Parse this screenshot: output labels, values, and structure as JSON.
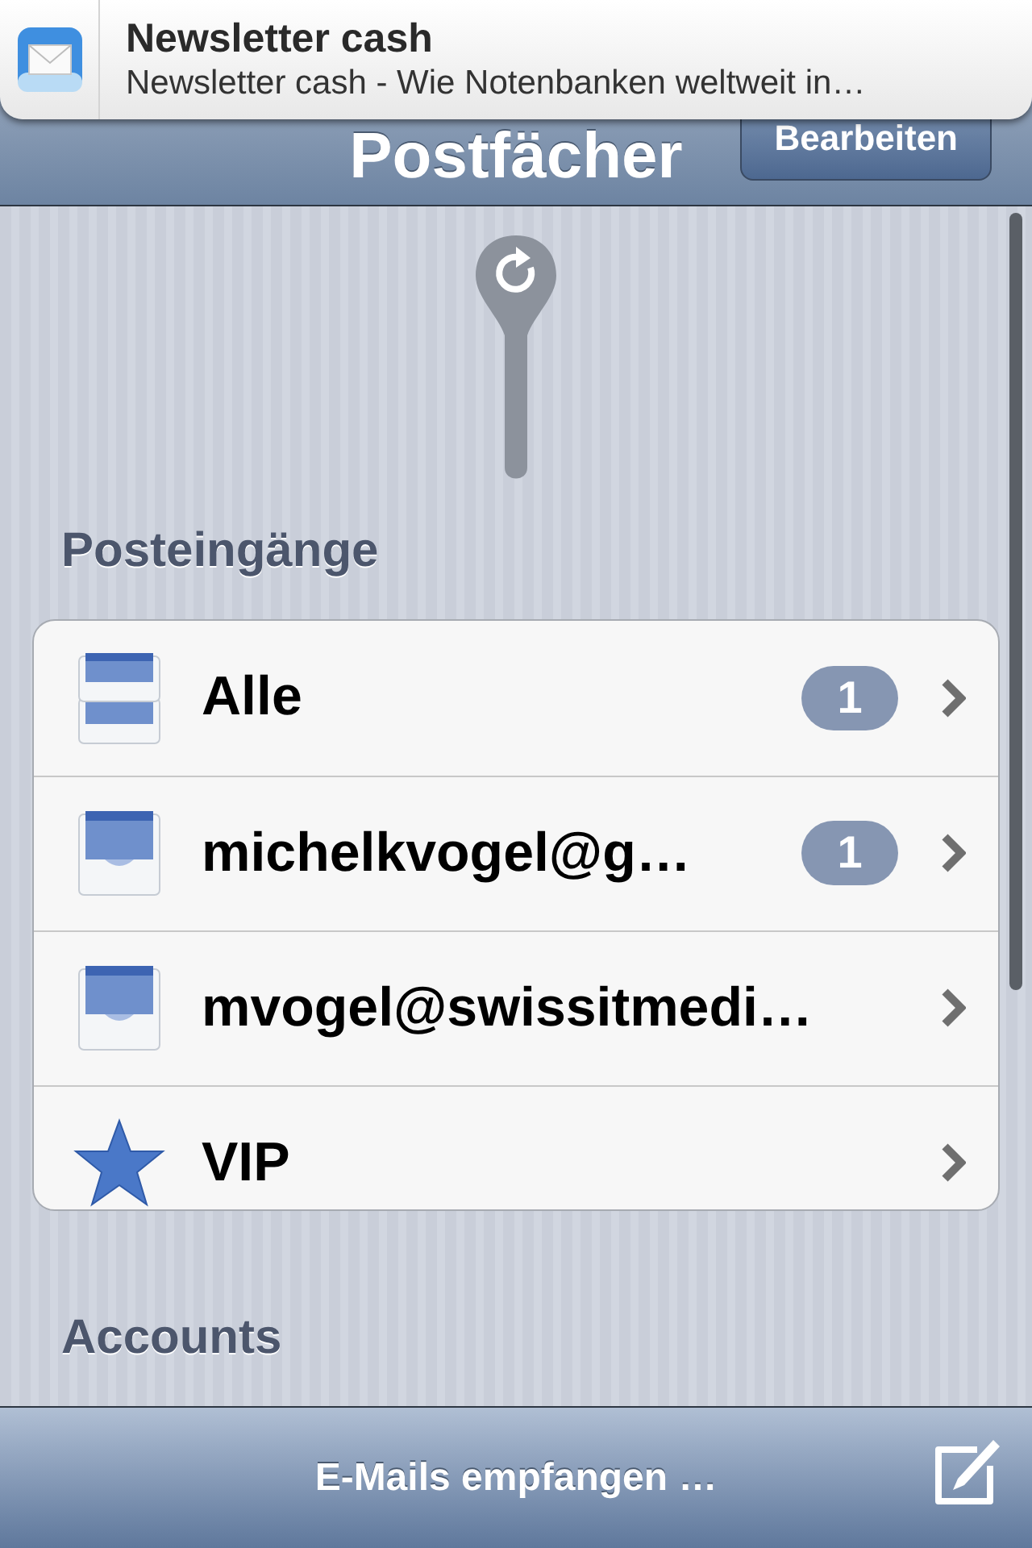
{
  "notification": {
    "title": "Newsletter cash",
    "message": "Newsletter cash - Wie Notenbanken weltweit in…"
  },
  "navigation_bar": {
    "title": "Postfächer",
    "edit_button": "Bearbeiten"
  },
  "sections": [
    {
      "header": "Posteingänge",
      "rows": [
        {
          "kind": "all-inboxes",
          "label": "Alle",
          "badge": "1"
        },
        {
          "kind": "inbox",
          "label": "michelkvogel@g…",
          "badge": "1"
        },
        {
          "kind": "inbox",
          "label": "mvogel@swissitmedi…"
        },
        {
          "kind": "star",
          "label": "VIP"
        }
      ]
    },
    {
      "header": "Accounts"
    }
  ],
  "toolbar": {
    "status": "E-Mails empfangen …"
  }
}
